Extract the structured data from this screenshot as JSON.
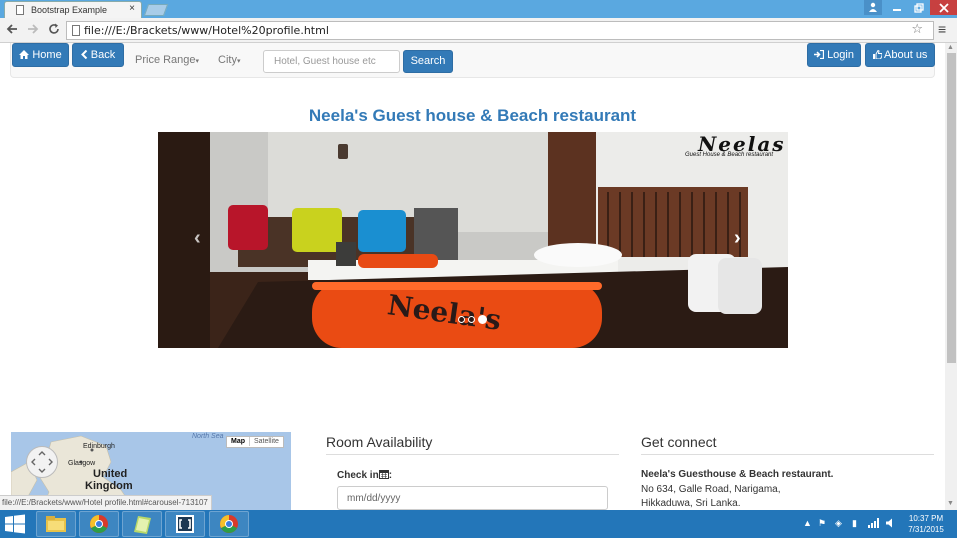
{
  "browser": {
    "tab_title": "Bootstrap Example",
    "tab_close": "×",
    "url": "file:///E:/Brackets/www/Hotel%20profile.html"
  },
  "navbar": {
    "home": "Home",
    "back": "Back",
    "price_range": "Price Range",
    "city": "City",
    "search_placeholder": "Hotel, Guest house etc",
    "search": "Search",
    "login": "Login",
    "about": "About us"
  },
  "hotel": {
    "title": "Neela's Guest house & Beach restaurant",
    "carousel": {
      "logo": "Neelas",
      "logo_sub": "Guest House & Beach restaurant",
      "towel_text": "Neela's",
      "active_slide": 3,
      "slide_count": 3
    }
  },
  "map": {
    "labels": [
      "North Sea",
      "Edinburgh",
      "Glasgow",
      "United",
      "Kingdom"
    ],
    "map_btn": "Map",
    "satellite_btn": "Satellite"
  },
  "room": {
    "heading": "Room Availability",
    "checkin_label": "Check in",
    "checkin_placeholder": "mm/dd/yyyy"
  },
  "connect": {
    "heading": "Get connect",
    "name": "Neela's Guesthouse & Beach restaurant.",
    "line1": "No 634, Galle Road, Narigama,",
    "line2": "Hikkaduwa, Sri Lanka."
  },
  "status_url": "file:///E:/Brackets/www/Hotel profile.html#carousel-713107",
  "taskbar": {
    "time": "10:37 PM",
    "date": "7/31/2015"
  },
  "colors": {
    "primary": "#337ab7",
    "taskbar": "#2376b9",
    "titlebar": "#5aa8e0"
  }
}
